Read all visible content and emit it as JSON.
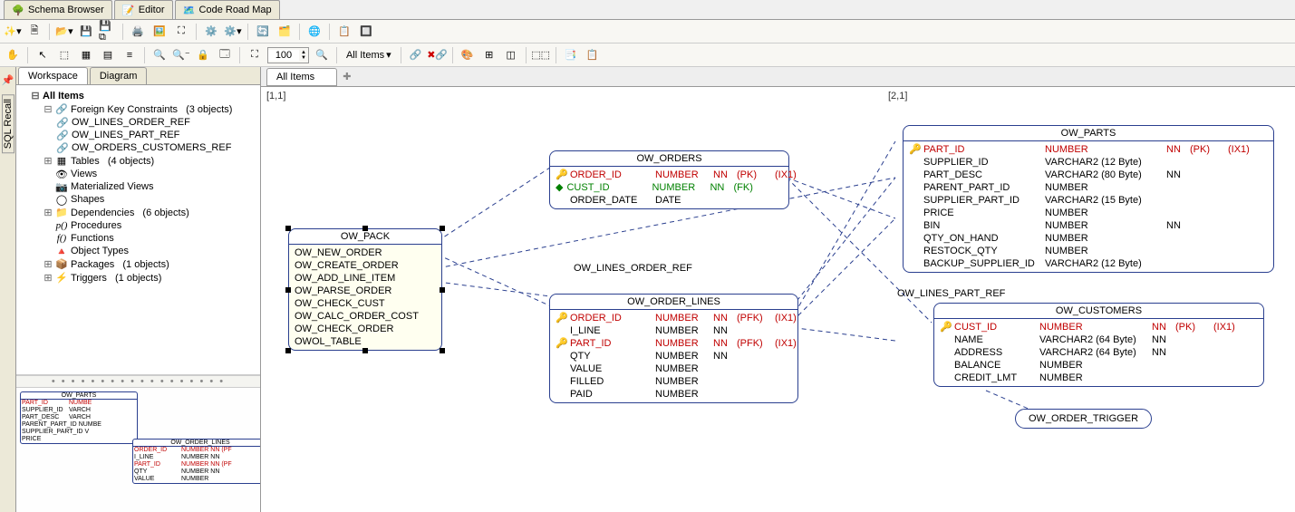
{
  "mainTabs": [
    {
      "label": "Schema Browser",
      "icon": "tree-icon"
    },
    {
      "label": "Editor",
      "icon": "edit-icon"
    },
    {
      "label": "Code Road Map",
      "icon": "map-icon"
    }
  ],
  "sideLabel": "SQL Recall",
  "toolbar2": {
    "zoom": "100",
    "filter": "All Items"
  },
  "leftTabs": [
    "Workspace",
    "Diagram"
  ],
  "tree": {
    "root": "All Items",
    "fk": {
      "label": "Foreign Key Constraints",
      "count": "(3 objects)",
      "items": [
        "OW_LINES_ORDER_REF",
        "OW_LINES_PART_REF",
        "OW_ORDERS_CUSTOMERS_REF"
      ]
    },
    "tables": {
      "label": "Tables",
      "count": "(4 objects)"
    },
    "views": "Views",
    "mviews": "Materialized Views",
    "shapes": "Shapes",
    "deps": {
      "label": "Dependencies",
      "count": "(6 objects)"
    },
    "procs": "Procedures",
    "funcs": "Functions",
    "otypes": "Object Types",
    "pkgs": {
      "label": "Packages",
      "count": "(1 objects)"
    },
    "trigs": {
      "label": "Triggers",
      "count": "(1 objects)"
    }
  },
  "canvasTab": "All Items",
  "coord1": "[1,1]",
  "coord2": "[2,1]",
  "fk1": "OW_LINES_ORDER_REF",
  "fk2": "OW_LINES_PART_REF",
  "entities": {
    "ow_pack": {
      "title": "OW_PACK",
      "rows": [
        [
          "OW_NEW_ORDER"
        ],
        [
          "OW_CREATE_ORDER"
        ],
        [
          "OW_ADD_LINE_ITEM"
        ],
        [
          "OW_PARSE_ORDER"
        ],
        [
          "OW_CHECK_CUST"
        ],
        [
          "OW_CALC_ORDER_COST"
        ],
        [
          "OW_CHECK_ORDER"
        ],
        [
          "OWOL_TABLE"
        ]
      ]
    },
    "ow_orders": {
      "title": "OW_ORDERS",
      "rows": [
        {
          "ic": "pk",
          "name": "ORDER_ID",
          "type": "NUMBER",
          "nn": "NN",
          "key": "(PK)",
          "ix": "(IX1)",
          "cls": "red"
        },
        {
          "ic": "fk",
          "name": "CUST_ID",
          "type": "NUMBER",
          "nn": "NN",
          "key": "(FK)",
          "ix": "",
          "cls": "green"
        },
        {
          "ic": "",
          "name": "ORDER_DATE",
          "type": "DATE",
          "nn": "",
          "key": "",
          "ix": "",
          "cls": ""
        }
      ]
    },
    "ow_order_lines": {
      "title": "OW_ORDER_LINES",
      "rows": [
        {
          "ic": "pk",
          "name": "ORDER_ID",
          "type": "NUMBER",
          "nn": "NN",
          "key": "(PFK)",
          "ix": "(IX1)",
          "cls": "red"
        },
        {
          "ic": "",
          "name": "I_LINE",
          "type": "NUMBER",
          "nn": "NN",
          "key": "",
          "ix": "",
          "cls": ""
        },
        {
          "ic": "pk",
          "name": "PART_ID",
          "type": "NUMBER",
          "nn": "NN",
          "key": "(PFK)",
          "ix": "(IX1)",
          "cls": "red"
        },
        {
          "ic": "",
          "name": "QTY",
          "type": "NUMBER",
          "nn": "NN",
          "key": "",
          "ix": "",
          "cls": ""
        },
        {
          "ic": "",
          "name": "VALUE",
          "type": "NUMBER",
          "nn": "",
          "key": "",
          "ix": "",
          "cls": ""
        },
        {
          "ic": "",
          "name": "FILLED",
          "type": "NUMBER",
          "nn": "",
          "key": "",
          "ix": "",
          "cls": ""
        },
        {
          "ic": "",
          "name": "PAID",
          "type": "NUMBER",
          "nn": "",
          "key": "",
          "ix": "",
          "cls": ""
        }
      ]
    },
    "ow_parts": {
      "title": "OW_PARTS",
      "rows": [
        {
          "ic": "pk",
          "name": "PART_ID",
          "type": "NUMBER",
          "nn": "NN",
          "key": "(PK)",
          "ix": "(IX1)",
          "cls": "red"
        },
        {
          "ic": "",
          "name": "SUPPLIER_ID",
          "type": "VARCHAR2 (12 Byte)",
          "nn": "",
          "key": "",
          "ix": "",
          "cls": ""
        },
        {
          "ic": "",
          "name": "PART_DESC",
          "type": "VARCHAR2 (80 Byte)",
          "nn": "NN",
          "key": "",
          "ix": "",
          "cls": ""
        },
        {
          "ic": "",
          "name": "PARENT_PART_ID",
          "type": "NUMBER",
          "nn": "",
          "key": "",
          "ix": "",
          "cls": ""
        },
        {
          "ic": "",
          "name": "SUPPLIER_PART_ID",
          "type": "VARCHAR2 (15 Byte)",
          "nn": "",
          "key": "",
          "ix": "",
          "cls": ""
        },
        {
          "ic": "",
          "name": "PRICE",
          "type": "NUMBER",
          "nn": "",
          "key": "",
          "ix": "",
          "cls": ""
        },
        {
          "ic": "",
          "name": "BIN",
          "type": "NUMBER",
          "nn": "NN",
          "key": "",
          "ix": "",
          "cls": ""
        },
        {
          "ic": "",
          "name": "QTY_ON_HAND",
          "type": "NUMBER",
          "nn": "",
          "key": "",
          "ix": "",
          "cls": ""
        },
        {
          "ic": "",
          "name": "RESTOCK_QTY",
          "type": "NUMBER",
          "nn": "",
          "key": "",
          "ix": "",
          "cls": ""
        },
        {
          "ic": "",
          "name": "BACKUP_SUPPLIER_ID",
          "type": "VARCHAR2 (12 Byte)",
          "nn": "",
          "key": "",
          "ix": "",
          "cls": ""
        }
      ]
    },
    "ow_customers": {
      "title": "OW_CUSTOMERS",
      "rows": [
        {
          "ic": "pk",
          "name": "CUST_ID",
          "type": "NUMBER",
          "nn": "NN",
          "key": "(PK)",
          "ix": "(IX1)",
          "cls": "red"
        },
        {
          "ic": "",
          "name": "NAME",
          "type": "VARCHAR2 (64 Byte)",
          "nn": "NN",
          "key": "",
          "ix": "",
          "cls": ""
        },
        {
          "ic": "",
          "name": "ADDRESS",
          "type": "VARCHAR2 (64 Byte)",
          "nn": "NN",
          "key": "",
          "ix": "",
          "cls": ""
        },
        {
          "ic": "",
          "name": "BALANCE",
          "type": "NUMBER",
          "nn": "",
          "key": "",
          "ix": "",
          "cls": ""
        },
        {
          "ic": "",
          "name": "CREDIT_LMT",
          "type": "NUMBER",
          "nn": "",
          "key": "",
          "ix": "",
          "cls": ""
        }
      ]
    },
    "trigger": "OW_ORDER_TRIGGER"
  },
  "minimap": {
    "parts": {
      "title": "OW_PARTS",
      "rows": [
        [
          "PART_ID",
          "NUMBE",
          "red"
        ],
        [
          "SUPPLIER_ID",
          "VARCH",
          ""
        ],
        [
          "PART_DESC",
          "VARCH",
          ""
        ],
        [
          "PARENT_PART_ID",
          "NUMBE",
          ""
        ],
        [
          "SUPPLIER_PART_ID",
          "V",
          ""
        ],
        [
          "PRICE",
          "",
          ""
        ]
      ]
    },
    "lines": {
      "title": "OW_ORDER_LINES",
      "rows": [
        [
          "ORDER_ID",
          "NUMBER NN (PF",
          "red"
        ],
        [
          "I_LINE",
          "NUMBER NN",
          ""
        ],
        [
          "PART_ID",
          "NUMBER NN (PF",
          "red"
        ],
        [
          "QTY",
          "NUMBER NN",
          ""
        ],
        [
          "VALUE",
          "NUMBER",
          ""
        ]
      ]
    }
  }
}
